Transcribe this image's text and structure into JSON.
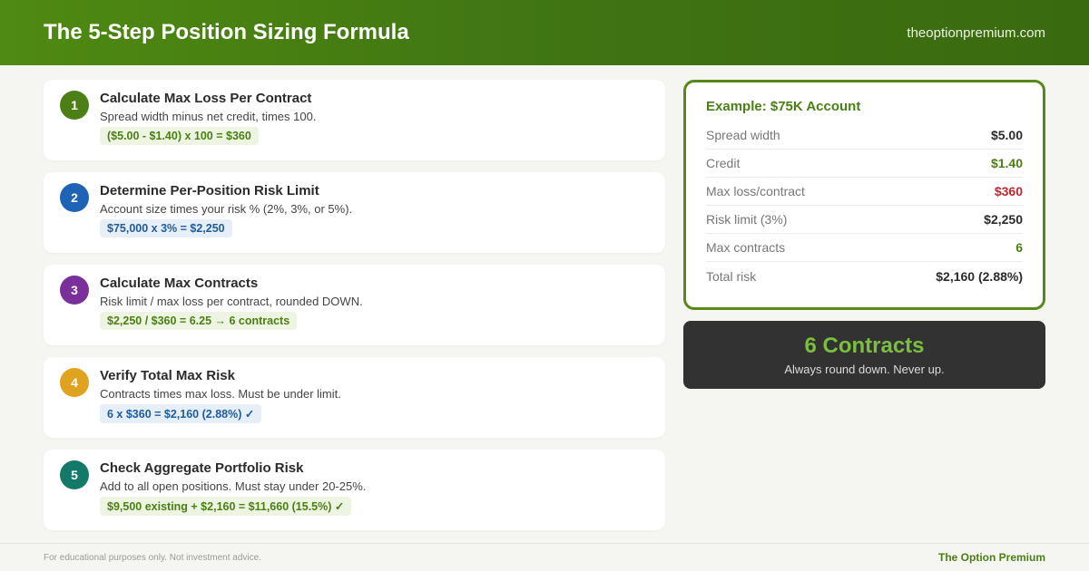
{
  "header": {
    "title": "The 5-Step Position Sizing Formula",
    "site": "theoptionpremium.com"
  },
  "steps": [
    {
      "number": "1",
      "color": "#4c7f17",
      "title": "Calculate Max Loss Per Contract",
      "description": "Spread width minus net credit, times 100.",
      "formula": "($5.00 - $1.40) x 100 = $360",
      "formula_style": "green"
    },
    {
      "number": "2",
      "color": "#1e63b5",
      "title": "Determine Per-Position Risk Limit",
      "description": "Account size times your risk % (2%, 3%, or 5%).",
      "formula": "$75,000 x 3% = $2,250",
      "formula_style": "blue"
    },
    {
      "number": "3",
      "color": "#7b2f9b",
      "title": "Calculate Max Contracts",
      "description": "Risk limit / max loss per contract, rounded DOWN.",
      "formula": "$2,250 / $360 = 6.25 → 6 contracts",
      "formula_style": "green"
    },
    {
      "number": "4",
      "color": "#e0a320",
      "title": "Verify Total Max Risk",
      "description": "Contracts times max loss. Must be under limit.",
      "formula": "6 x $360 = $2,160 (2.88%) ✓",
      "formula_style": "blue"
    },
    {
      "number": "5",
      "color": "#137a6a",
      "title": "Check Aggregate Portfolio Risk",
      "description": "Add to all open positions. Must stay under 20-25%.",
      "formula": "$9,500 existing + $2,160 = $11,660 (15.5%) ✓",
      "formula_style": "green"
    }
  ],
  "example": {
    "title": "Example: $75K Account",
    "rows": [
      {
        "label": "Spread width",
        "value": "$5.00",
        "tone": "default"
      },
      {
        "label": "Credit",
        "value": "$1.40",
        "tone": "green"
      },
      {
        "label": "Max loss/contract",
        "value": "$360",
        "tone": "red"
      },
      {
        "label": "Risk limit (3%)",
        "value": "$2,250",
        "tone": "default"
      },
      {
        "label": "Max contracts",
        "value": "6",
        "tone": "green"
      },
      {
        "label": "Total risk",
        "value": "$2,160 (2.88%)",
        "tone": "default"
      }
    ]
  },
  "result": {
    "headline": "6 Contracts",
    "subtext": "Always round down. Never up."
  },
  "footer": {
    "disclaimer": "For educational purposes only. Not investment advice.",
    "brand": "The Option Premium"
  }
}
